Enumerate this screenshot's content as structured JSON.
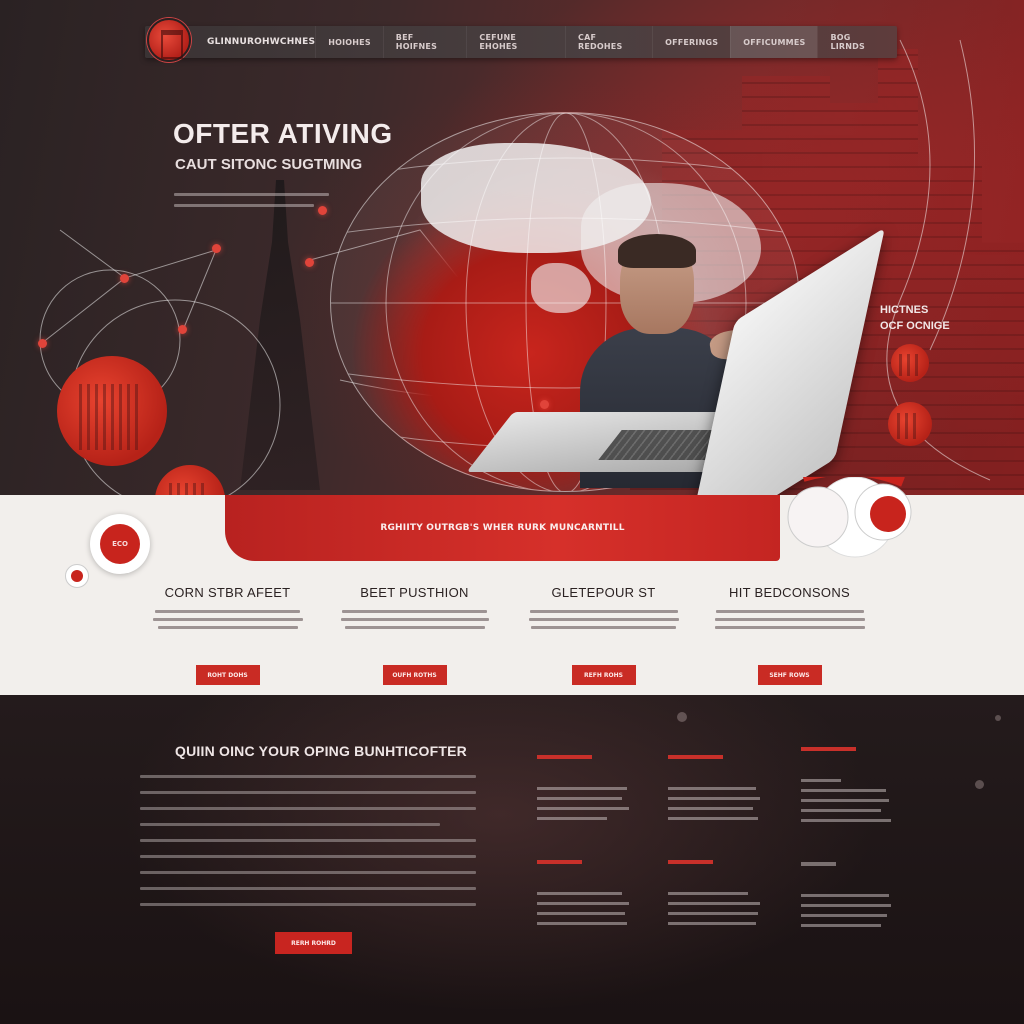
{
  "nav": {
    "brand": "GLINNUROHWCHNES",
    "items": [
      "HOIOHES",
      "BEF HOIFNES",
      "CEFUNE EHOHES",
      "CAF REDOHES",
      "OFFERINGS",
      "OFFICUMMES",
      "BOG LIRNDS"
    ],
    "active_index": 5
  },
  "hero": {
    "title": "OFTER ATIVING",
    "subtitle": "CAUT SITONC SUGTMING",
    "side_label_line1": "HICTNES",
    "side_label_line2": "OCF OCNIGE"
  },
  "band": {
    "banner_text": "RGHIITY OUTRGB'S WHER RURK MUNCARNTILL",
    "badge_text": "ECO"
  },
  "features": [
    {
      "title": "CORN STBR AFEET",
      "button": "ROHT DOHS"
    },
    {
      "title": "BEET PUSTHION",
      "button": "OUFH ROTHS"
    },
    {
      "title": "GLETEPOUR ST",
      "button": "REFH ROHS"
    },
    {
      "title": "HIT BEDCONSONS",
      "button": "SEHF ROWS"
    }
  ],
  "bottom": {
    "heading": "QUIIN OINC YOUR OPING BUNHTICOFTER",
    "cta": "RERH ROHRD"
  },
  "colors": {
    "accent": "#c8241d",
    "band_bg": "#f2efec",
    "dark_bg": "#1a1314"
  }
}
